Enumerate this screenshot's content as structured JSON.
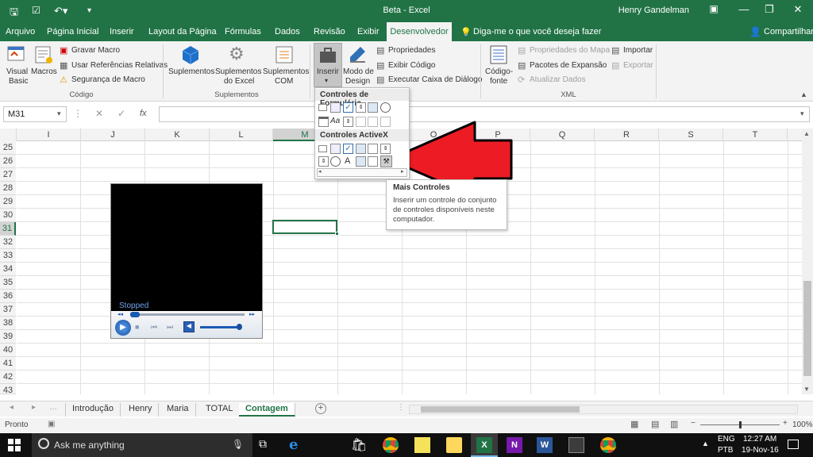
{
  "titlebar": {
    "title": "Beta  -  Excel",
    "user": "Henry Gandelman"
  },
  "tabs": [
    "Arquivo",
    "Página Inicial",
    "Inserir",
    "Layout da Página",
    "Fórmulas",
    "Dados",
    "Revisão",
    "Exibir",
    "Desenvolvedor"
  ],
  "tell_me": "Diga-me o que você deseja fazer",
  "share": "Compartilhar",
  "ribbon": {
    "visual_basic": [
      "Visual",
      "Basic"
    ],
    "macros": "Macros",
    "record_macro": "Gravar Macro",
    "relative_refs": "Usar Referências Relativas",
    "macro_security": "Segurança de Macro",
    "group_code": "Código",
    "addins": "Suplementos",
    "excel_addins": [
      "Suplementos",
      "do Excel"
    ],
    "com_addins": [
      "Suplementos",
      "COM"
    ],
    "group_addins": "Suplementos",
    "insert": "Inserir",
    "design_mode": [
      "Modo de",
      "Design"
    ],
    "properties": "Propriedades",
    "view_code": "Exibir Código",
    "run_dialog": "Executar Caixa de Diálogo",
    "source": [
      "Código-",
      "fonte"
    ],
    "map_props": "Propriedades do Mapa",
    "expansion_packs": "Pacotes de Expansão",
    "refresh_data": "Atualizar Dados",
    "import": "Importar",
    "export": "Exportar",
    "group_xml": "XML"
  },
  "namebox": "M31",
  "columns": [
    "I",
    "J",
    "K",
    "L",
    "M",
    "N",
    "O",
    "P",
    "Q",
    "R",
    "S",
    "T"
  ],
  "rows": [
    "25",
    "26",
    "27",
    "28",
    "29",
    "30",
    "31",
    "32",
    "33",
    "34",
    "35",
    "36",
    "37",
    "38",
    "39",
    "40",
    "41",
    "42",
    "43"
  ],
  "player": {
    "status": "Stopped"
  },
  "dropdown": {
    "form_controls": "Controles de Formulário",
    "activex": "Controles ActiveX",
    "label_glyph": "Aa",
    "a_glyph": "A"
  },
  "tooltip": {
    "title": "Mais Controles",
    "body": "Inserir um controle do conjunto de controles disponíveis neste computador."
  },
  "sheets": [
    "Introdução",
    "Henry",
    "Maria",
    "TOTAL",
    "Contagem"
  ],
  "status": {
    "ready": "Pronto",
    "zoom": "100%"
  },
  "taskbar": {
    "search": "Ask me anything",
    "lang1": "ENG",
    "lang2": "PTB",
    "time": "12:27 AM",
    "date": "19-Nov-16"
  },
  "colors": {
    "excel_green": "#217346",
    "arrow_red": "#ed1c24"
  }
}
